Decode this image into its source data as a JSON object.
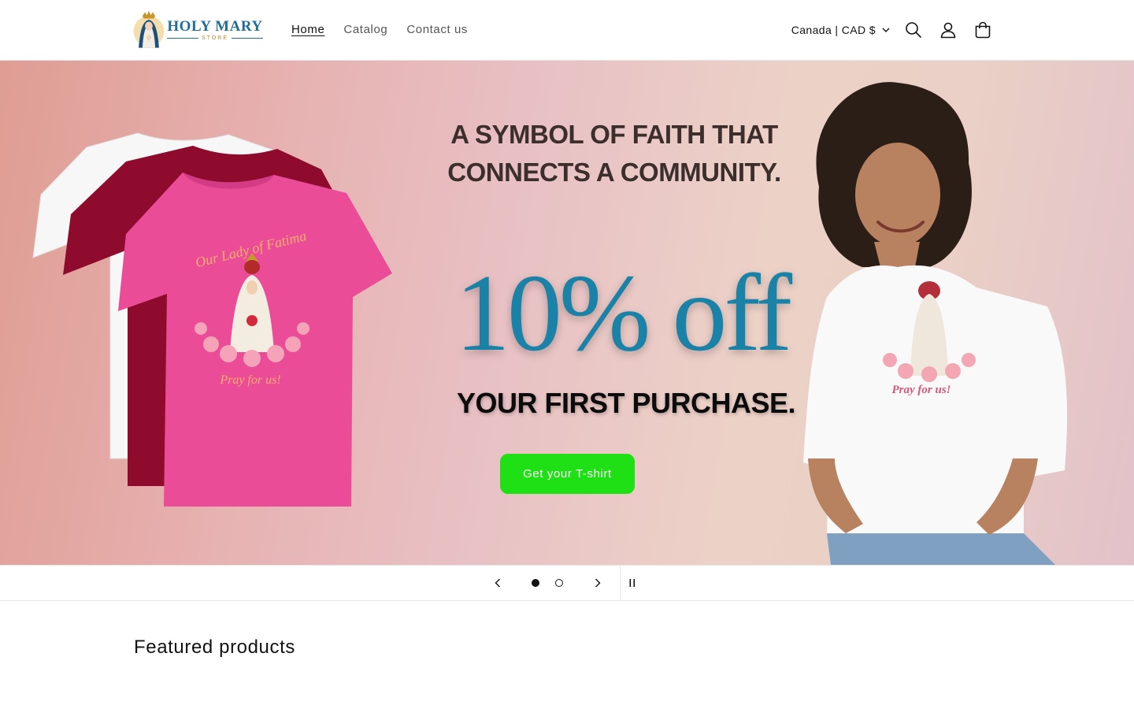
{
  "brand": {
    "name": "HOLY MARY",
    "tagline": "STORE"
  },
  "nav": {
    "items": [
      {
        "label": "Home",
        "active": true
      },
      {
        "label": "Catalog",
        "active": false
      },
      {
        "label": "Contact us",
        "active": false
      }
    ]
  },
  "header": {
    "locale": "Canada | CAD $",
    "icons": [
      "search-icon",
      "account-icon",
      "cart-icon"
    ]
  },
  "hero": {
    "headline_line1": "A SYMBOL OF FAITH THAT",
    "headline_line2": "CONNECTS A COMMUNITY.",
    "discount": "10% off",
    "subline": "YOUR FIRST PURCHASE.",
    "shirt_text_top": "Our Lady of Fatima",
    "shirt_text_bottom": "Pray for us!",
    "cta_label": "Get your T-shirt",
    "colors": {
      "cta": "#1fe015",
      "discount": "#1a82a6"
    }
  },
  "slideshow": {
    "total_slides": 2,
    "current_slide": 1
  },
  "featured": {
    "title": "Featured products"
  }
}
